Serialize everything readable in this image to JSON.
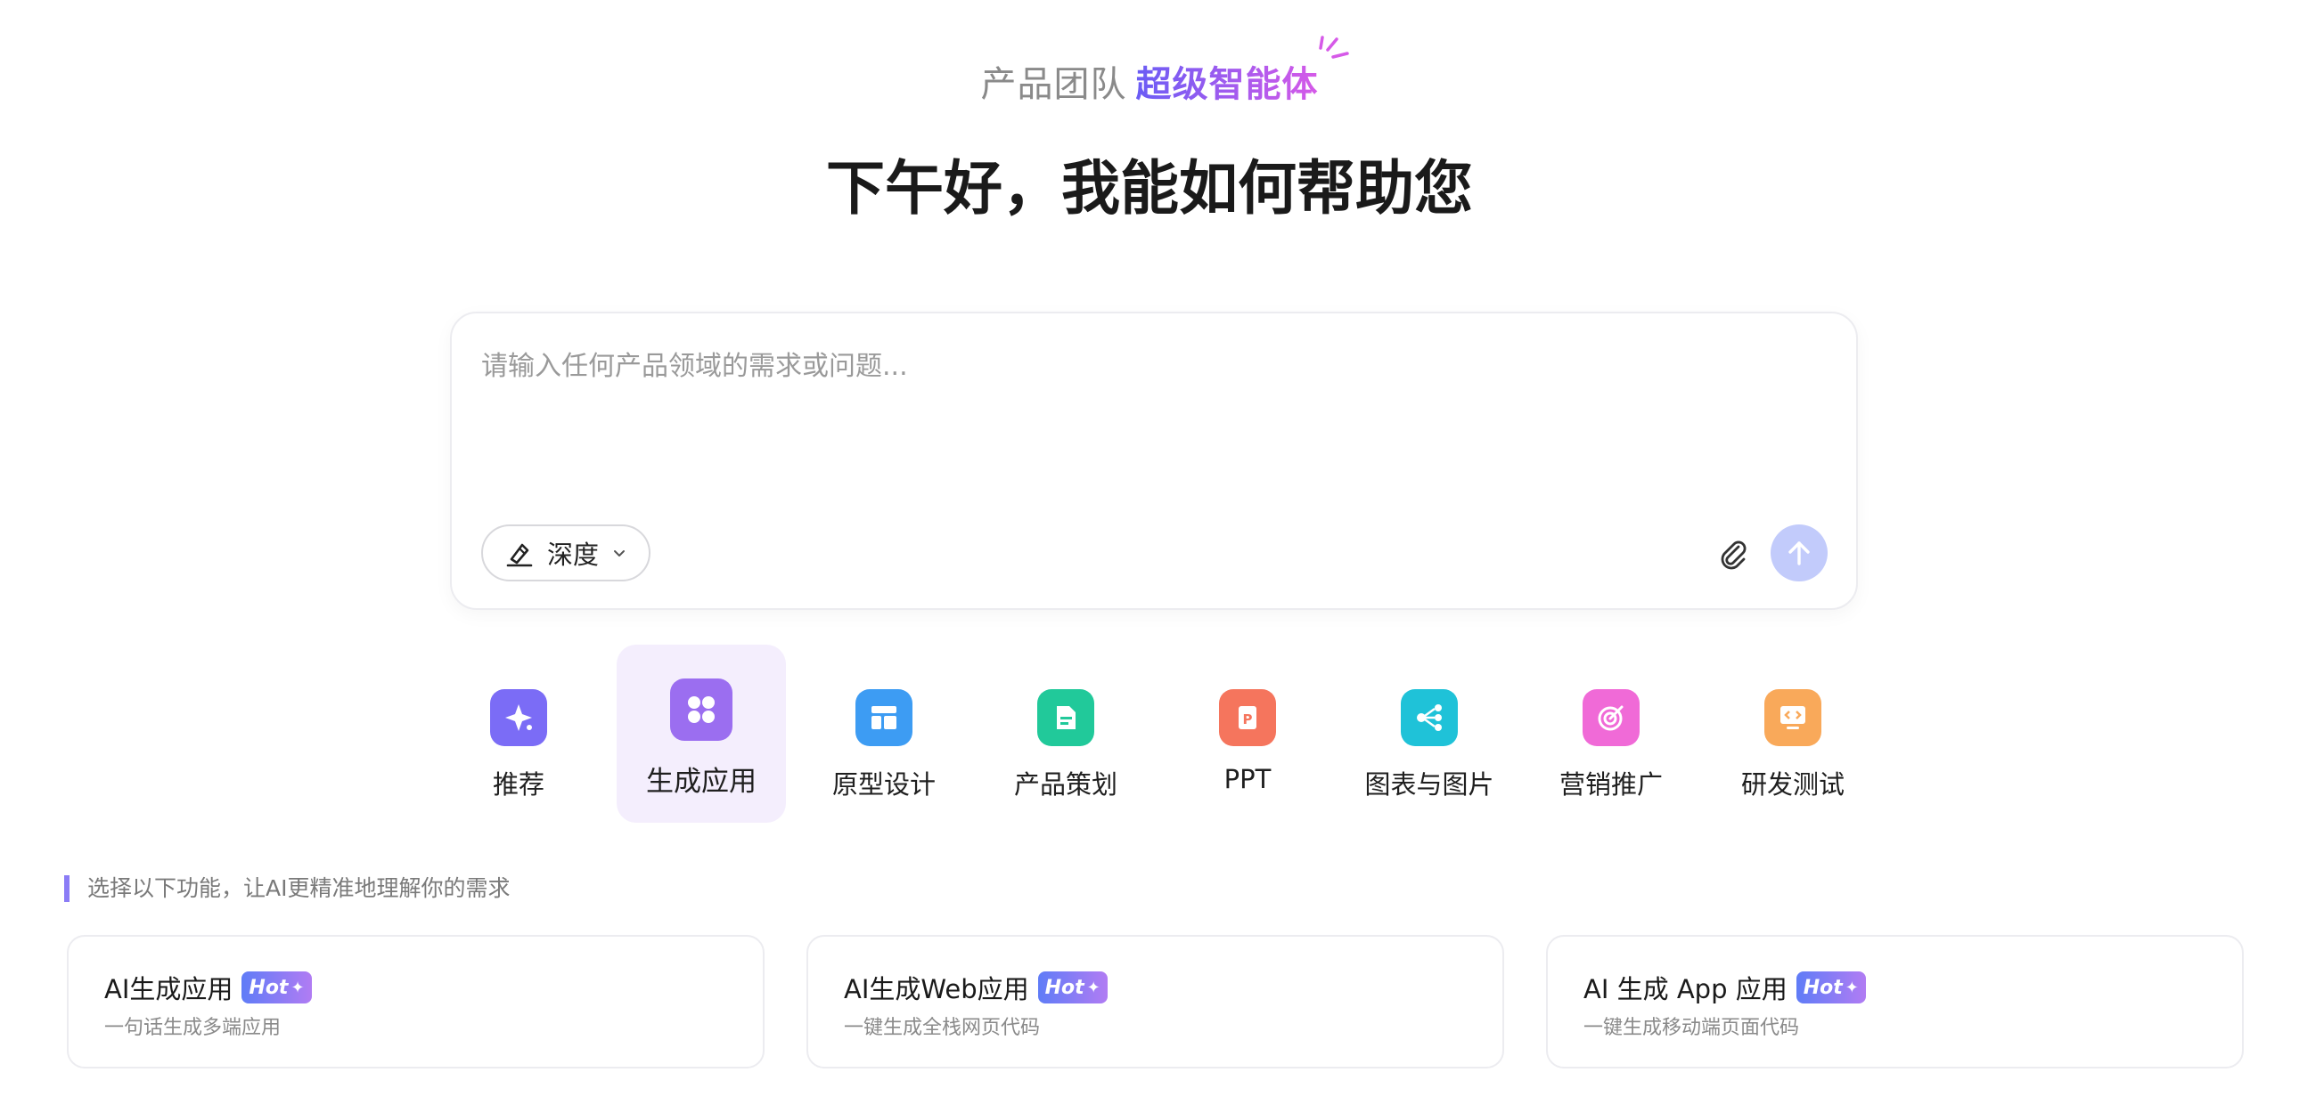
{
  "header": {
    "team": "产品团队",
    "agent": "超级智能体",
    "greeting": "下午好，我能如何帮助您"
  },
  "composer": {
    "placeholder": "请输入任何产品领域的需求或问题...",
    "mode_label": "深度"
  },
  "categories": [
    {
      "label": "推荐",
      "color": "#7b6cf6",
      "icon": "sparkle-icon"
    },
    {
      "label": "生成应用",
      "color": "#9b6ef0",
      "icon": "apps-grid-icon",
      "active": true
    },
    {
      "label": "原型设计",
      "color": "#3d9cf3",
      "icon": "layout-icon"
    },
    {
      "label": "产品策划",
      "color": "#21c99a",
      "icon": "document-icon"
    },
    {
      "label": "PPT",
      "color": "#f5755d",
      "icon": "ppt-icon"
    },
    {
      "label": "图表与图片",
      "color": "#1fc2d8",
      "icon": "diagram-icon"
    },
    {
      "label": "营销推广",
      "color": "#f06ad7",
      "icon": "target-icon"
    },
    {
      "label": "研发测试",
      "color": "#f9a95a",
      "icon": "code-icon"
    }
  ],
  "hint": "选择以下功能，让AI更精准地理解你的需求",
  "cards": [
    {
      "title": "AI生成应用",
      "badge": "Hot",
      "desc": "一句话生成多端应用"
    },
    {
      "title": "AI生成Web应用",
      "badge": "Hot",
      "desc": "一键生成全栈网页代码"
    },
    {
      "title": "AI 生成 App 应用",
      "badge": "Hot",
      "desc": "一键生成移动端页面代码"
    }
  ]
}
